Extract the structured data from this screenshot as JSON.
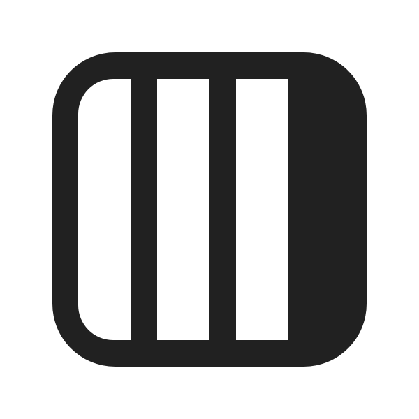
{
  "icon": {
    "name": "board-columns-icon",
    "colors": {
      "foreground": "#212121",
      "background": "#ffffff"
    }
  }
}
